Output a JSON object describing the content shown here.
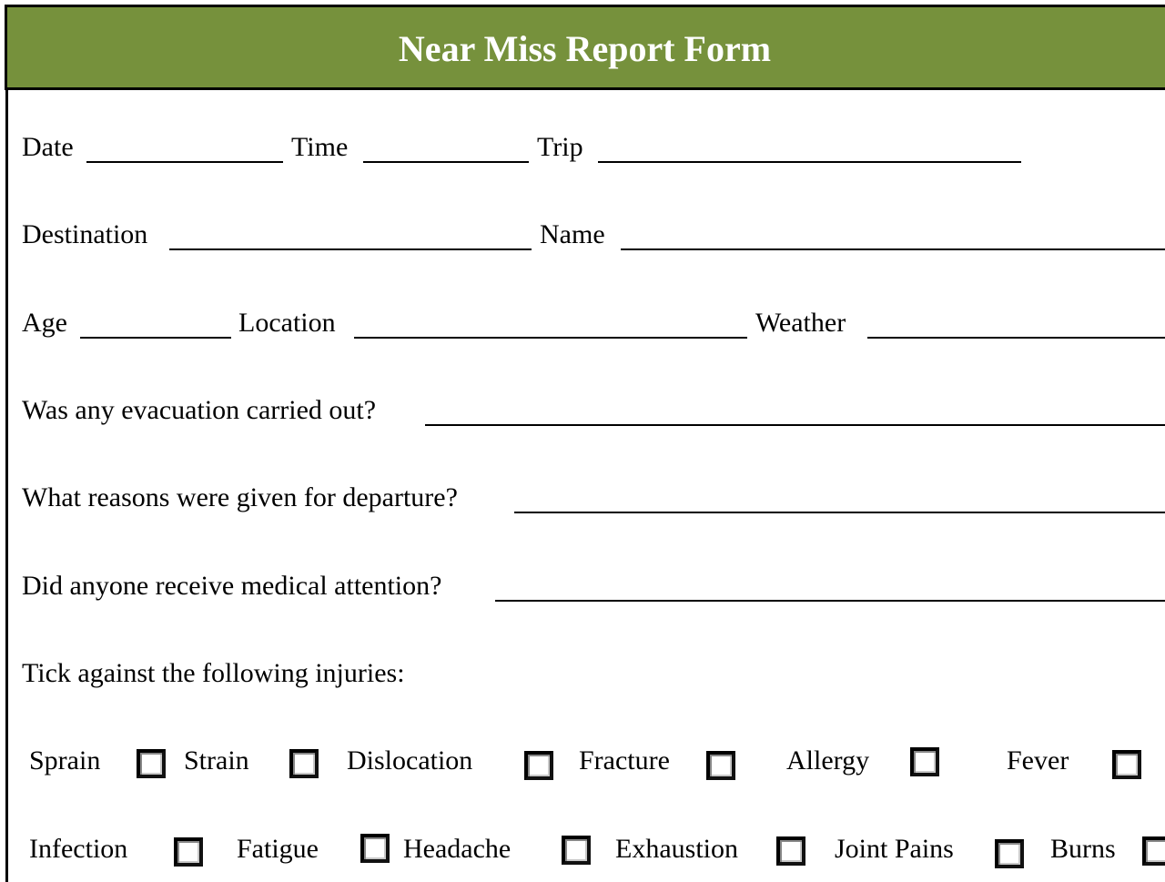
{
  "header": {
    "title": "Near Miss Report Form",
    "background_color": "#76913c"
  },
  "fields": {
    "date": {
      "label": "Date",
      "value": ""
    },
    "time": {
      "label": "Time",
      "value": ""
    },
    "trip": {
      "label": "Trip",
      "value": ""
    },
    "destination": {
      "label": "Destination",
      "value": ""
    },
    "name": {
      "label": "Name",
      "value": ""
    },
    "age": {
      "label": "Age",
      "value": ""
    },
    "location": {
      "label": "Location",
      "value": ""
    },
    "weather": {
      "label": "Weather",
      "value": ""
    },
    "evacuation": {
      "label": "Was any evacuation carried out?",
      "value": ""
    },
    "departure": {
      "label": "What reasons were given for departure?",
      "value": ""
    },
    "medical": {
      "label": "Did anyone receive medical attention?",
      "value": ""
    }
  },
  "injuries": {
    "heading": "Tick against the following injuries:",
    "row1": [
      {
        "label": "Sprain",
        "checked": false
      },
      {
        "label": "Strain",
        "checked": false
      },
      {
        "label": "Dislocation",
        "checked": false
      },
      {
        "label": "Fracture",
        "checked": false
      },
      {
        "label": "Allergy",
        "checked": false
      },
      {
        "label": "Fever",
        "checked": false
      }
    ],
    "row2": [
      {
        "label": "Infection",
        "checked": false
      },
      {
        "label": "Fatigue",
        "checked": false
      },
      {
        "label": "Headache",
        "checked": false
      },
      {
        "label": "Exhaustion",
        "checked": false
      },
      {
        "label": "Joint Pains",
        "checked": false
      },
      {
        "label": "Burns",
        "checked": false
      }
    ]
  }
}
